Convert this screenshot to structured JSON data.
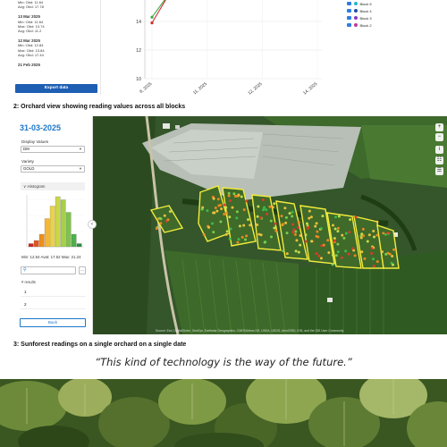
{
  "top": {
    "dates": [
      {
        "title": "",
        "lines": [
          "Min: Obd: 11.64",
          "Avg: Obd: 17.78"
        ]
      },
      {
        "title": "13 Mar 2025",
        "lines": [
          "Min: Obd: 11.64",
          "Max: Obd: 13.74",
          "Avg: Obd: 11.2"
        ]
      },
      {
        "title": "12 Mar 2025",
        "lines": [
          "Min: Obd: 12.84",
          "Max: Obd: 13.84",
          "Avg: Obd: 17.44"
        ]
      },
      {
        "title": "21 Feb 2025",
        "lines": []
      }
    ],
    "export_label": "Export data",
    "legend": [
      {
        "label": "Block 5",
        "color": "#25b6c9"
      },
      {
        "label": "Block 4",
        "color": "#1f4fa8"
      },
      {
        "label": "Block 3",
        "color": "#8a39c4"
      },
      {
        "label": "Block 2",
        "color": "#c0399a"
      }
    ]
  },
  "chart_data": {
    "type": "line",
    "x": [
      "8, 2025",
      "11, 2025",
      "12, 2025",
      "14, 2025"
    ],
    "y_ticks": [
      10,
      12,
      14
    ],
    "ylim": [
      10,
      15.5
    ],
    "series": [
      {
        "values": [
          14.3,
          16.0
        ],
        "color": "#3aa845"
      },
      {
        "values": [
          13.9,
          16.0
        ],
        "color": "#d62b2b"
      }
    ]
  },
  "captions": {
    "c1": "2: Orchard view showing reading values across all blocks",
    "c2": "3: Sunforest readings on a single orchard on a single date"
  },
  "sidebar": {
    "date": "31-03-2025",
    "display_values_label": "Display Values",
    "display_values_value": "DM",
    "variety_label": "Variety",
    "variety_value": "GOLD",
    "histogram_label": "Histogram",
    "stats": "Min: 12.54 Avat: 17.52 Max: 21.24",
    "results_label": "# results",
    "results": [
      "1",
      "2"
    ],
    "back_label": "Back",
    "histogram": [
      1,
      2,
      4,
      9,
      13,
      16,
      15,
      11,
      4,
      1
    ],
    "histogram_colors": [
      "#c62828",
      "#e0571f",
      "#ef8f1a",
      "#f4b63b",
      "#e9d24a",
      "#c9d845",
      "#a7cf4a",
      "#7fc24e",
      "#4fae4e",
      "#2e8f3f"
    ]
  },
  "map": {
    "attribution": "Source: Esri, DigitalGlobe, GeoEye, Earthstar Geographics, CNES/Airbus DS, USDA, USGS, AeroGRID, IGN, and the GIS User Community"
  },
  "quote": "“This kind of technology is the way of the future.”"
}
